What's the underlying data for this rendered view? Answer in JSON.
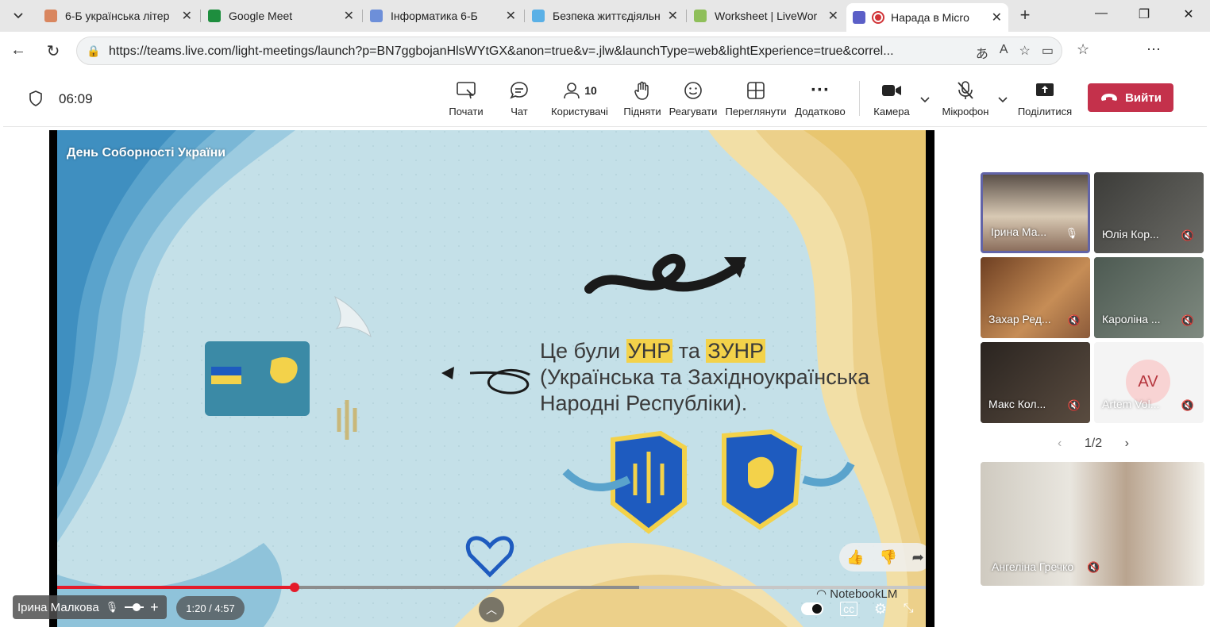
{
  "browser": {
    "tabs": [
      {
        "title": "6-Б українська літер",
        "color": "#d9865f",
        "active": false
      },
      {
        "title": "Google Meet",
        "color": "#1e8e3e",
        "active": false
      },
      {
        "title": "Інформатика 6-Б",
        "color": "#6d8fd9",
        "active": false
      },
      {
        "title": "Безпека життєдіяльн",
        "color": "#5ab0e6",
        "active": false
      },
      {
        "title": "Worksheet | LiveWor",
        "color": "#8fbf5a",
        "active": false
      },
      {
        "title": "Нарада в Micro",
        "color": "#d13438",
        "active": true
      }
    ],
    "url": "https://teams.live.com/light-meetings/launch?p=BN7ggbojanHlsWYtGX&anon=true&v=.jlw&launchType=web&lightExperience=true&correl..."
  },
  "meeting": {
    "timer": "06:09",
    "toolbar": {
      "start": "Почати",
      "chat": "Чат",
      "people": "Користувачі",
      "people_count": "10",
      "raise": "Підняти",
      "react": "Реагувати",
      "view": "Переглянути",
      "more": "Додатково",
      "camera": "Камера",
      "mic": "Мікрофон",
      "share": "Поділитися",
      "leave": "Вийти"
    },
    "slide": {
      "caption": "День Соборності України",
      "line1_pre": "Це були ",
      "line1_hl1": "УНР",
      "line1_mid": " та ",
      "line1_hl2": "ЗУНР",
      "line2": "(Українська та Західноукраїнська",
      "line3": "Народні Республіки).",
      "brand": "NotebookLM"
    },
    "video": {
      "time": "1:20 / 4:57",
      "progress": 0.273,
      "buffered_start": 0.67,
      "buffered_end": 1.0
    },
    "presenter": "Ірина Малкова",
    "participants": [
      {
        "name": "Ірина Ма...",
        "muted": false,
        "active": true,
        "bg": "#8a7a6a"
      },
      {
        "name": "Юлія Кор...",
        "muted": true,
        "active": false,
        "bg": "#4d4d4a"
      },
      {
        "name": "Захар Ред...",
        "muted": true,
        "active": false,
        "bg": "#8b5a3a"
      },
      {
        "name": "Кароліна ...",
        "muted": true,
        "active": false,
        "bg": "#5f6a62"
      },
      {
        "name": "Макс Кол...",
        "muted": true,
        "active": false,
        "bg": "#3b332e"
      },
      {
        "name": "Artem Vol...",
        "muted": true,
        "active": false,
        "bg": "#f4f4f4",
        "initials": "AV"
      }
    ],
    "pager": "1/2",
    "pinned": {
      "name": "Ангеліна Гречко"
    }
  }
}
